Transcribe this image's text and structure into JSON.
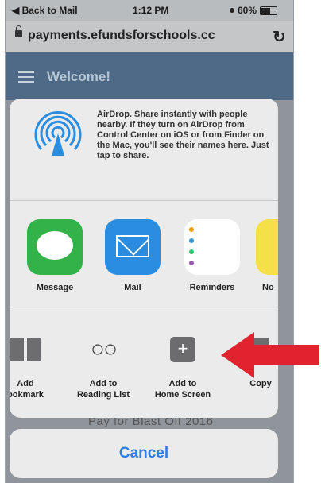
{
  "status_bar": {
    "back_label": "◀ Back to Mail",
    "time": "1:12 PM",
    "battery": "60%"
  },
  "url_bar": {
    "url": "payments.efundsforschools.cc"
  },
  "page": {
    "welcome": "Welcome!",
    "bottom_text": "Pay for Blast Off 2016"
  },
  "airdrop": {
    "text": "AirDrop. Share instantly with people nearby. If they turn on AirDrop from Control Center on iOS or from Finder on the Mac, you'll see their names here. Just tap to share."
  },
  "apps": [
    {
      "label": "Message",
      "icon": "messages-icon"
    },
    {
      "label": "Mail",
      "icon": "mail-icon"
    },
    {
      "label": "Reminders",
      "icon": "reminders-icon"
    },
    {
      "label": "No",
      "icon": "notes-icon"
    }
  ],
  "actions": [
    {
      "label": "Add\nookmark",
      "icon": "bookmark-icon"
    },
    {
      "label": "Add to\nReading List",
      "icon": "reading-glasses-icon"
    },
    {
      "label": "Add to\nHome Screen",
      "icon": "plus-square-icon"
    },
    {
      "label": "Copy",
      "icon": "copy-icon"
    }
  ],
  "cancel_label": "Cancel",
  "colors": {
    "accent": "#2f7de3",
    "annotation_arrow": "#e0232e"
  }
}
